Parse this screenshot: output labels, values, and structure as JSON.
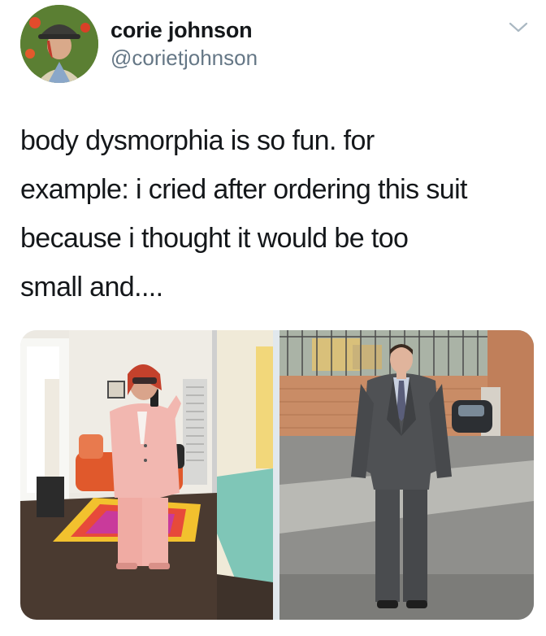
{
  "tweet": {
    "display_name": "corie johnson",
    "handle": "@corietjohnson",
    "text": "body dysmorphia is so fun. for example: i cried after ordering this suit because i thought it would be too small and....",
    "lines": [
      "body dysmorphia is so fun. for",
      "example: i cried after ordering this suit",
      "because i thought it would be too",
      "small and...."
    ]
  },
  "icons": {
    "avatar": "avatar-photo",
    "menu": "chevron-down-icon"
  },
  "colors": {
    "name": "#14171a",
    "handle": "#657786",
    "caret": "#aab8c2"
  }
}
